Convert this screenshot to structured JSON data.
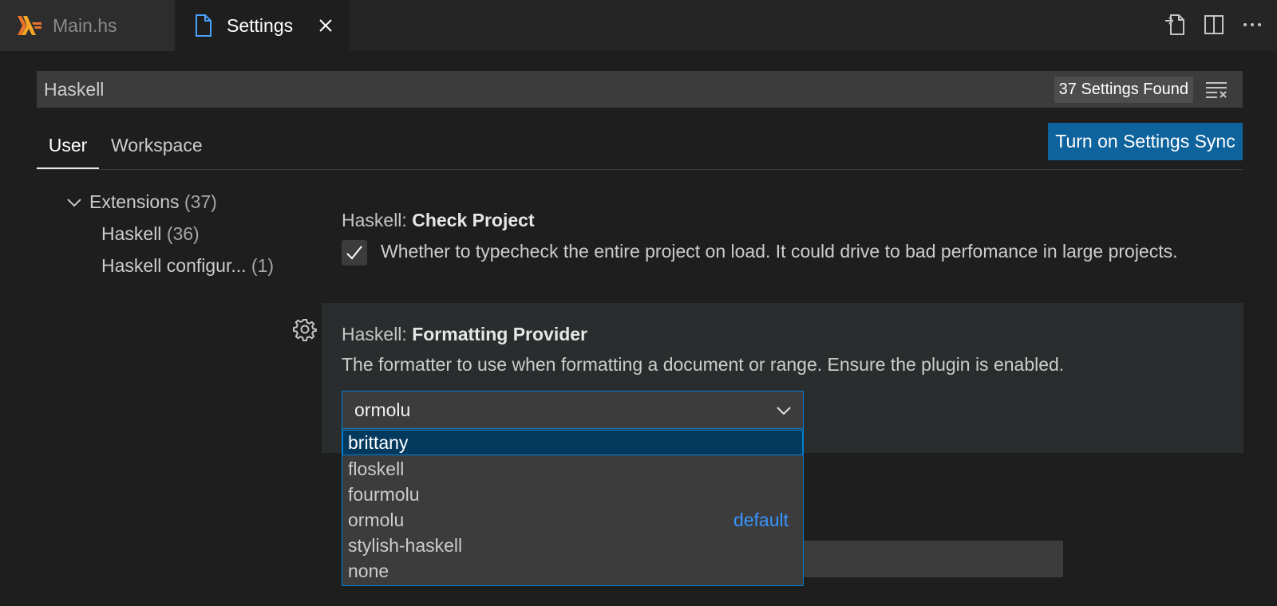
{
  "tabs": {
    "main": {
      "label": "Main.hs",
      "icon": "haskell-icon"
    },
    "settings": {
      "label": "Settings",
      "icon": "file-icon"
    }
  },
  "editor_actions": [
    "open-settings-json-icon",
    "split-editor-icon",
    "more-actions-icon"
  ],
  "search": {
    "value": "Haskell",
    "results_badge": "37 Settings Found"
  },
  "scope_tabs": {
    "user": "User",
    "workspace": "Workspace"
  },
  "sync_button": "Turn on Settings Sync",
  "toc": {
    "extensions": {
      "label": "Extensions",
      "count": "(37)"
    },
    "haskell": {
      "label": "Haskell",
      "count": "(36)"
    },
    "haskell_config": {
      "label": "Haskell configur...",
      "count": "(1)"
    }
  },
  "settings": {
    "check_project": {
      "category": "Haskell: ",
      "name": "Check Project",
      "checked": true,
      "description": "Whether to typecheck the entire project on load. It could drive to bad perfomance in large projects."
    },
    "formatting_provider": {
      "category": "Haskell: ",
      "name": "Formatting Provider",
      "description": "The formatter to use when formatting a document or range. Ensure the plugin is enabled.",
      "value": "ormolu",
      "options": [
        "brittany",
        "floskell",
        "fourmolu",
        "ormolu",
        "stylish-haskell",
        "none"
      ],
      "highlighted_option": "brittany",
      "default_tag": "default"
    }
  },
  "colors": {
    "accent": "#0e639c",
    "focus_border": "#007fd4",
    "haskell_logo": "#f5a623",
    "default_tag": "#3794ff"
  }
}
